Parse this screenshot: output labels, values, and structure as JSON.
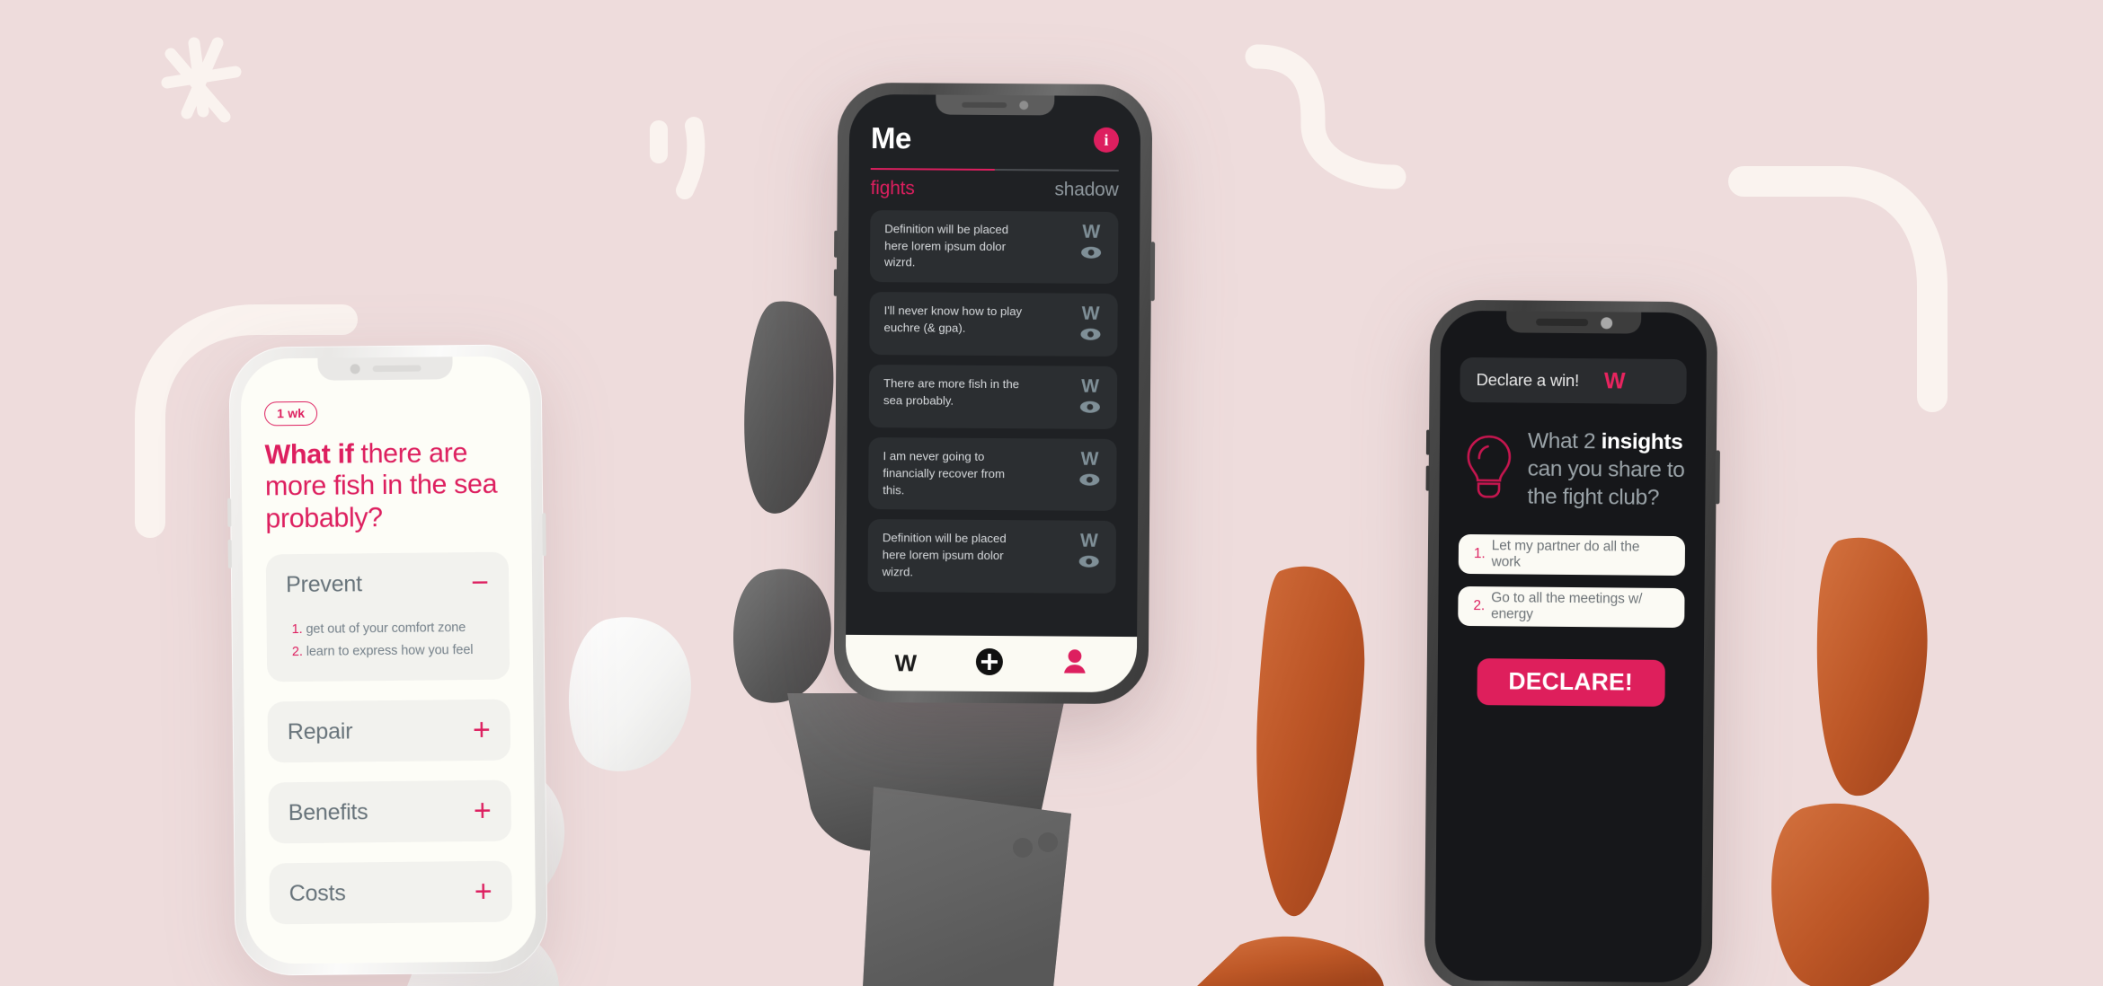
{
  "page": {
    "background_color": "#eedcdc",
    "accent_color": "#dd1f5f"
  },
  "decorations": {
    "starburst": "starburst-icon",
    "quote_strokes": "quote-strokes-icon",
    "s_curve": "s-curve-icon",
    "arc_left": "arc-icon",
    "arc_right": "arc-icon"
  },
  "left_phone": {
    "chip_label": "1 wk",
    "question_bold": "What if",
    "question_rest": " there are more fish in the sea probably?",
    "sections": [
      {
        "title": "Prevent",
        "toggle": "−",
        "expanded": true,
        "items": [
          {
            "num": "1.",
            "text": "get out of your comfort zone"
          },
          {
            "num": "2.",
            "text": "learn to express how you feel"
          }
        ]
      },
      {
        "title": "Repair",
        "toggle": "+",
        "expanded": false,
        "items": []
      },
      {
        "title": "Benefits",
        "toggle": "+",
        "expanded": false,
        "items": []
      },
      {
        "title": "Costs",
        "toggle": "+",
        "expanded": false,
        "items": []
      }
    ]
  },
  "center_phone": {
    "title": "Me",
    "info_glyph": "i",
    "tabs": [
      {
        "label": "fights",
        "active": true
      },
      {
        "label": "shadow",
        "active": false
      }
    ],
    "cards": [
      {
        "text": "Definition will be placed here lorem ipsum dolor wizrd.",
        "w": "W",
        "eye": "eye-icon"
      },
      {
        "text": "I'll never know how to play euchre (& gpa).",
        "w": "W",
        "eye": "eye-icon"
      },
      {
        "text": "There are more fish in the sea probably.",
        "w": "W",
        "eye": "eye-icon"
      },
      {
        "text": "I am never going to financially recover from this.",
        "w": "W",
        "eye": "eye-icon"
      },
      {
        "text": "Definition will be placed here lorem ipsum dolor wizrd.",
        "w": "W",
        "eye": "eye-icon"
      }
    ],
    "tabbar": {
      "w_label": "W",
      "add_icon": "plus-circle-icon",
      "profile_icon": "person-icon"
    }
  },
  "right_phone": {
    "declare_bar": {
      "label": "Declare a win!",
      "w": "W"
    },
    "bulb_icon": "lightbulb-icon",
    "insight_q_pre": "What 2 ",
    "insight_q_bold": "insights",
    "insight_q_post": " can you share to the fight club?",
    "items": [
      {
        "num": "1.",
        "text": "Let my partner do all the work"
      },
      {
        "num": "2.",
        "text": "Go to all the meetings w/ energy"
      }
    ],
    "declare_button": "DECLARE!"
  }
}
